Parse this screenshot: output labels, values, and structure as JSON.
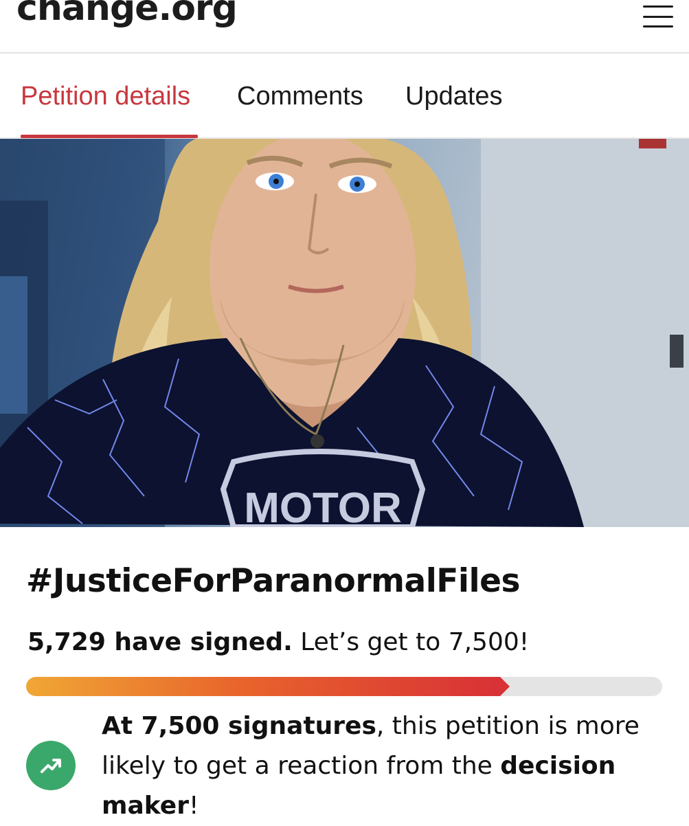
{
  "header": {
    "logo_text": "change.org",
    "menu_icon": "hamburger-menu-icon"
  },
  "tabs": [
    {
      "label": "Petition details",
      "active": true
    },
    {
      "label": "Comments",
      "active": false
    },
    {
      "label": "Updates",
      "active": false
    }
  ],
  "hero": {
    "shirt_text": "MOTOR"
  },
  "petition": {
    "title": "#JusticeForParanormalFiles",
    "signed_count": "5,729 have signed.",
    "goal_text": " Let’s get to 7,500!",
    "progress_fraction": 0.76,
    "milestone_bold": "At 7,500 signatures",
    "milestone_text_1": ", this petition is more likely to get a reaction from the ",
    "milestone_bold_2": "decision maker",
    "milestone_text_2": "!",
    "milestone_icon": "trending-up-icon"
  },
  "colors": {
    "accent_red": "#c8373e",
    "progress_start": "#f0a735",
    "progress_end": "#d83136",
    "trend_green": "#3aa86a"
  }
}
